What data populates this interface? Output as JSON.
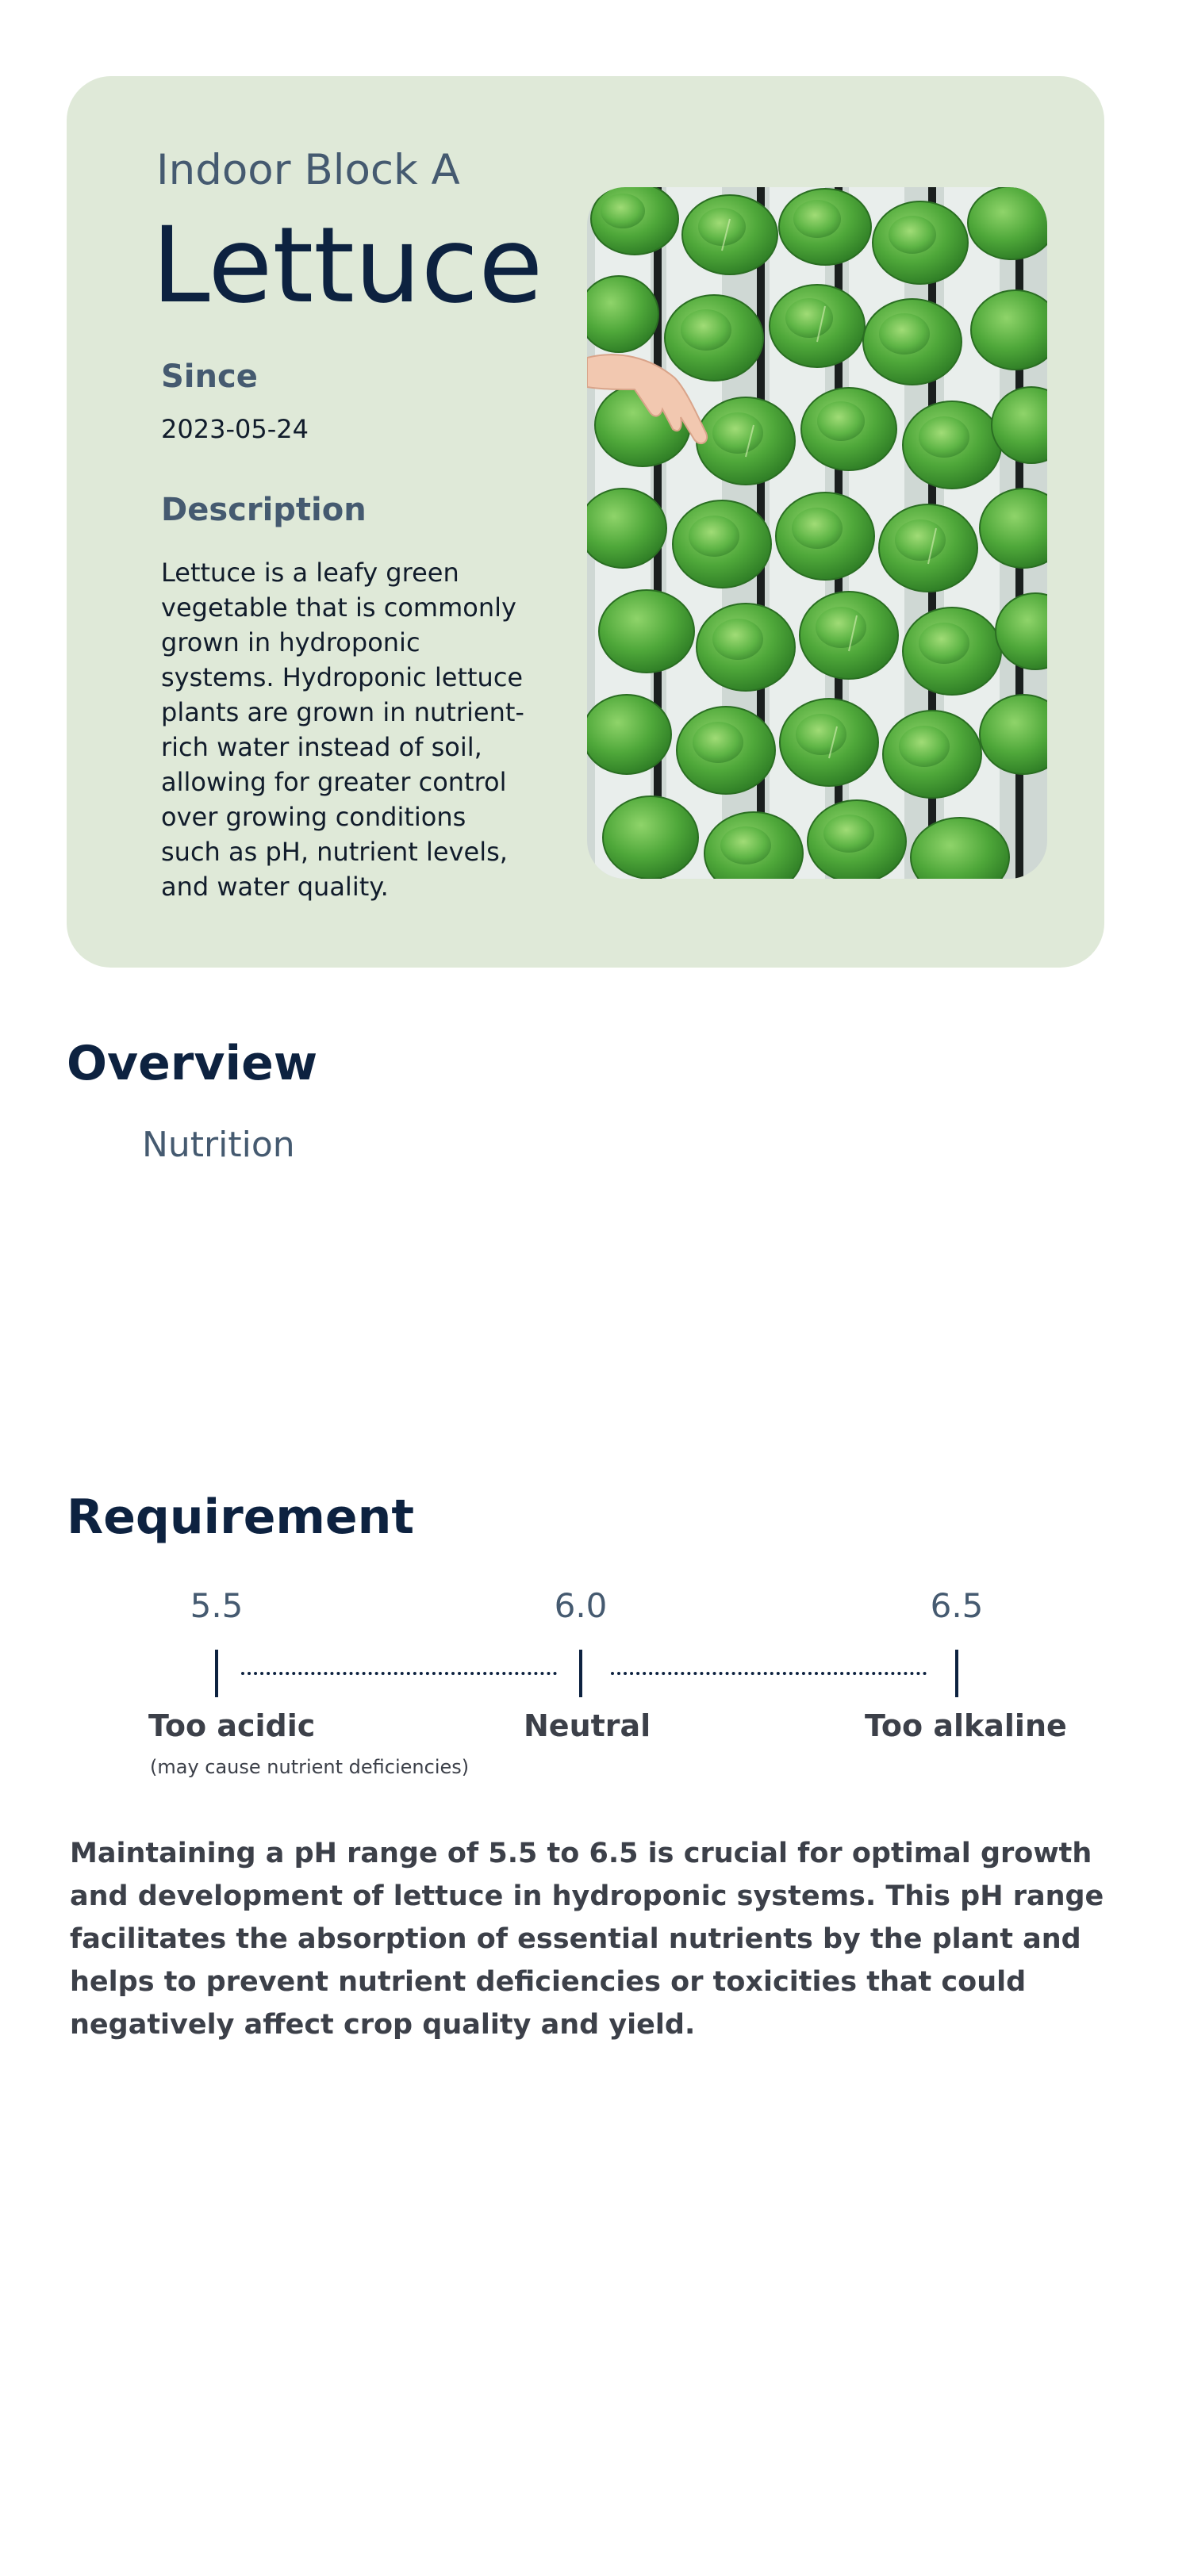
{
  "hero": {
    "location": "Indoor Block A",
    "plant_name": "Lettuce",
    "since_label": "Since",
    "since_value": "2023-05-24",
    "description_label": "Description",
    "description_text": "Lettuce is a leafy green vegetable that is commonly grown in hydroponic systems. Hydroponic lettuce plants are grown in nutrient-rich water instead of soil, allowing for greater control over growing conditions such as pH, nutrient levels, and water quality.",
    "background_color": "#dfe9d8"
  },
  "overview": {
    "title": "Overview",
    "nutrition_label": "Nutrition"
  },
  "requirement": {
    "title": "Requirement",
    "ph_scale": {
      "values": [
        "5.5",
        "6.0",
        "6.5"
      ],
      "zones": [
        "Too acidic",
        "Neutral",
        "Too alkaline"
      ],
      "acidic_note": "(may cause nutrient deficiencies)"
    },
    "text": "Maintaining a pH range of 5.5 to 6.5 is crucial for optimal growth and development of lettuce in hydroponic systems. This pH range facilitates the absorption of essential nutrients by the plant and helps to prevent nutrient deficiencies or toxicities that could negatively affect crop quality and yield."
  },
  "colors": {
    "heading": "#0d2240",
    "subheading": "#455a70",
    "body": "#3c4049"
  }
}
